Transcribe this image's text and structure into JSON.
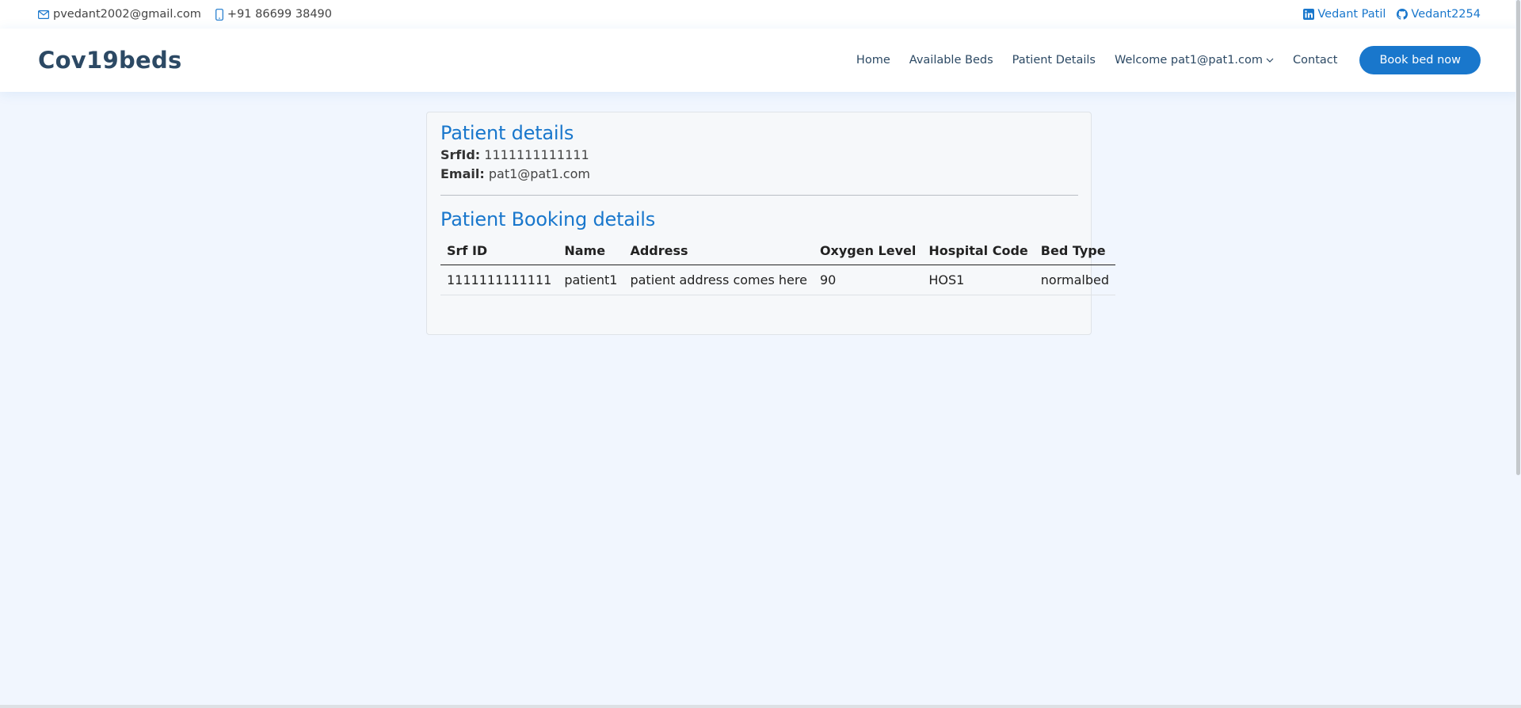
{
  "topbar": {
    "email": "pvedant2002@gmail.com",
    "phone": "+91 86699 38490",
    "linkedin": "Vedant Patil",
    "github": "Vedant2254"
  },
  "header": {
    "logo": "Cov19beds",
    "nav": {
      "home": "Home",
      "available_beds": "Available Beds",
      "patient_details": "Patient Details",
      "welcome": "Welcome pat1@pat1.com",
      "contact": "Contact"
    },
    "cta": "Book bed now"
  },
  "patient": {
    "title": "Patient details",
    "srfid_label": "SrfId:",
    "srfid_value": "1111111111111",
    "email_label": "Email:",
    "email_value": "pat1@pat1.com"
  },
  "booking": {
    "title": "Patient Booking details",
    "headers": [
      "Srf ID",
      "Name",
      "Address",
      "Oxygen Level",
      "Hospital Code",
      "Bed Type"
    ],
    "rows": [
      [
        "1111111111111",
        "patient1",
        "patient address comes here",
        "90",
        "HOS1",
        "normalbed"
      ]
    ]
  },
  "colors": {
    "accent": "#1977cc",
    "heading": "#2c4964",
    "background": "#f1f6fe"
  },
  "icons": [
    "envelope-icon",
    "phone-icon",
    "linkedin-icon",
    "github-icon",
    "chevron-down-icon"
  ]
}
